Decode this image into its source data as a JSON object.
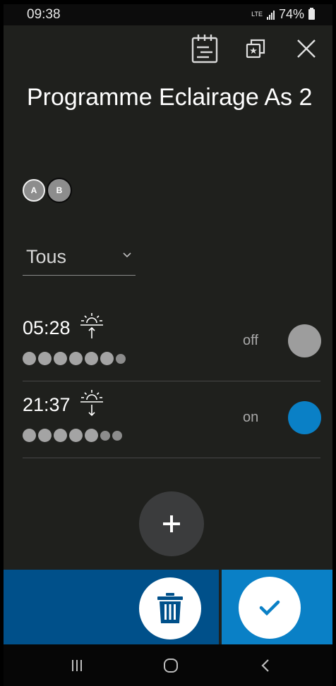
{
  "status_bar": {
    "time": "09:38",
    "network": "LTE",
    "battery": "74%"
  },
  "toolbar": {
    "icons": [
      "calendar-list-icon",
      "copy-star-icon",
      "close-icon"
    ]
  },
  "title": "Programme Eclairage As 2",
  "groups": [
    {
      "label": "A",
      "selected": true
    },
    {
      "label": "B",
      "selected": false
    }
  ],
  "day_filter": {
    "selected": "Tous"
  },
  "entries": [
    {
      "time": "05:28",
      "icon": "sunrise-icon",
      "state": "off",
      "state_color": "#9d9d9d",
      "days_active": [
        true,
        true,
        true,
        true,
        true,
        true,
        false
      ]
    },
    {
      "time": "21:37",
      "icon": "sunset-icon",
      "state": "on",
      "state_color": "#0a80c6",
      "days_active": [
        true,
        true,
        true,
        true,
        true,
        false,
        false
      ]
    }
  ],
  "actions": {
    "add": "plus-icon",
    "delete": "trash-icon",
    "confirm": "check-icon"
  },
  "colors": {
    "accent": "#0a80c6",
    "accent_dark": "#00508a",
    "background": "#1f201d"
  },
  "nav": [
    "recent-apps-icon",
    "home-icon",
    "back-icon"
  ]
}
